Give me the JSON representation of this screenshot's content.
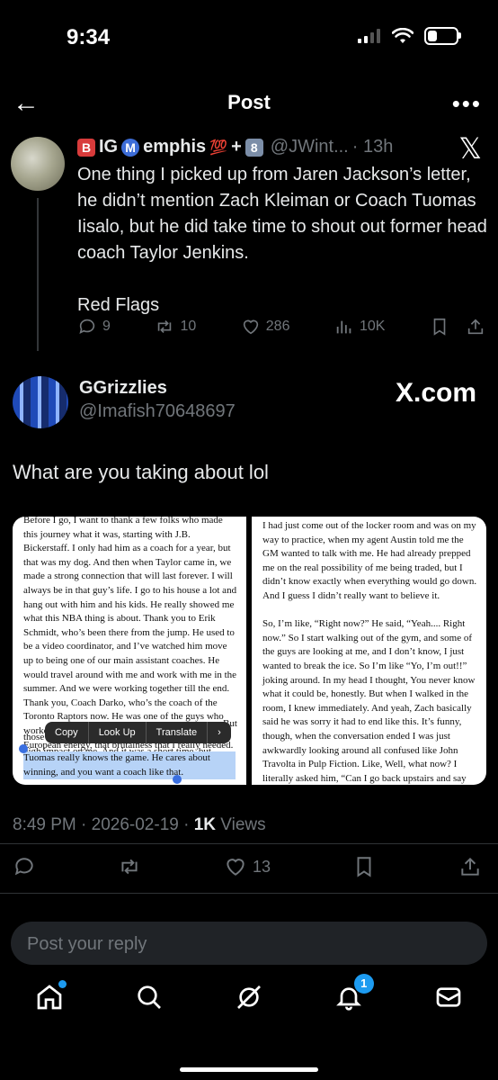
{
  "status_bar": {
    "time": "9:34"
  },
  "nav": {
    "back_icon": "←",
    "title": "Post",
    "more_icon": "•••"
  },
  "quoted_post": {
    "name_parts": [
      "🅱️",
      "IG",
      "Ⓜ️",
      "emphis",
      "💯",
      "+",
      "8"
    ],
    "name_display": [
      "B",
      "IG ",
      "M",
      "emphis",
      "💯",
      "+",
      "8"
    ],
    "handle": "@JWint...",
    "time": "· 13h",
    "text": "One thing I picked up from Jaren Jackson’s letter, he didn’t mention Zach Kleiman or Coach Tuomas Iisalo, but he did take time to shout out former head coach Taylor Jenkins.\n\nRed Flags",
    "replies": "9",
    "reposts": "10",
    "likes": "286",
    "views": "10K"
  },
  "post": {
    "author": "GGrizzlies",
    "handle": "@Imafish70648697",
    "watermark": "X.com",
    "text": "What are you taking about lol",
    "page_left": "Before I go, I want to thank a few folks who made this journey what it was, starting with J.B. Bickerstaff. I only had him as a coach for a year, but that was my dog. And then when Taylor came in, we made a strong connection that will last forever. I will always be in that guy’s life. I go to his house a lot and hang out with him and his kids. He really showed me what this NBA thing is about. Thank you to Erik Schmidt, who’s been there from the jump. He used to be a video coordinator, and I’ve watched him move up to being one of our main assistant coaches. He would travel around with me and work with me in the summer. And we were working together till the end. Thank you, Coach Darko, who’s the coach of the Toronto Raptors now. He was one of the guys who worked with me, too. He really brought that Eastern European energy, that brutalness that I really needed. I took bits and pieces from freaking every",
    "page_left_tail_a": "But",
    "page_left_line_b": "those",
    "page_left_line_c": "high impact on me. And it was a short time, but",
    "page_left_highlight": "Tuomas really knows the game. He cares about winning, and you want a coach like that.",
    "page_right": "I had just come out of the locker room and was on my way to practice, when my agent Austin told me the GM wanted to talk with me. He had already prepped me on the real possibility of me being traded, but I didn’t know exactly when everything would go down. And I guess I didn’t really want to believe it.\n\nSo, I’m like, “Right now?” He said, “Yeah.... Right now.” So I start walking out of the gym, and some of the guys are looking at me, and I don’t know, I just wanted to break the ice. So I’m like “Yo, I’m out!!” joking around. In my head I thought, You never know what it could be, honestly. But when I walked in the room, I knew immediately. And yeah, Zach basically said he was sorry it had to end like this. It’s funny, though, when the conversation ended I was just awkwardly looking around all confused like John Travolta in Pulp Fiction. Like, Well, what now? I literally asked him, “Can I go back upstairs and say bye?” Like he was gonna press a button, and the trap door was gonna open up.",
    "context_menu": [
      "Copy",
      "Look Up",
      "Translate",
      "›"
    ],
    "timestamp": "8:49 PM · 2026-02-19 · ",
    "views_count": "1K",
    "views_label": " Views",
    "likes": "13"
  },
  "reply": {
    "placeholder": "Post your reply"
  },
  "tabbar": {
    "notifications_badge": "1"
  },
  "colors": {
    "background": "#000000",
    "accent": "#1d9bf0",
    "muted": "#71767b"
  }
}
